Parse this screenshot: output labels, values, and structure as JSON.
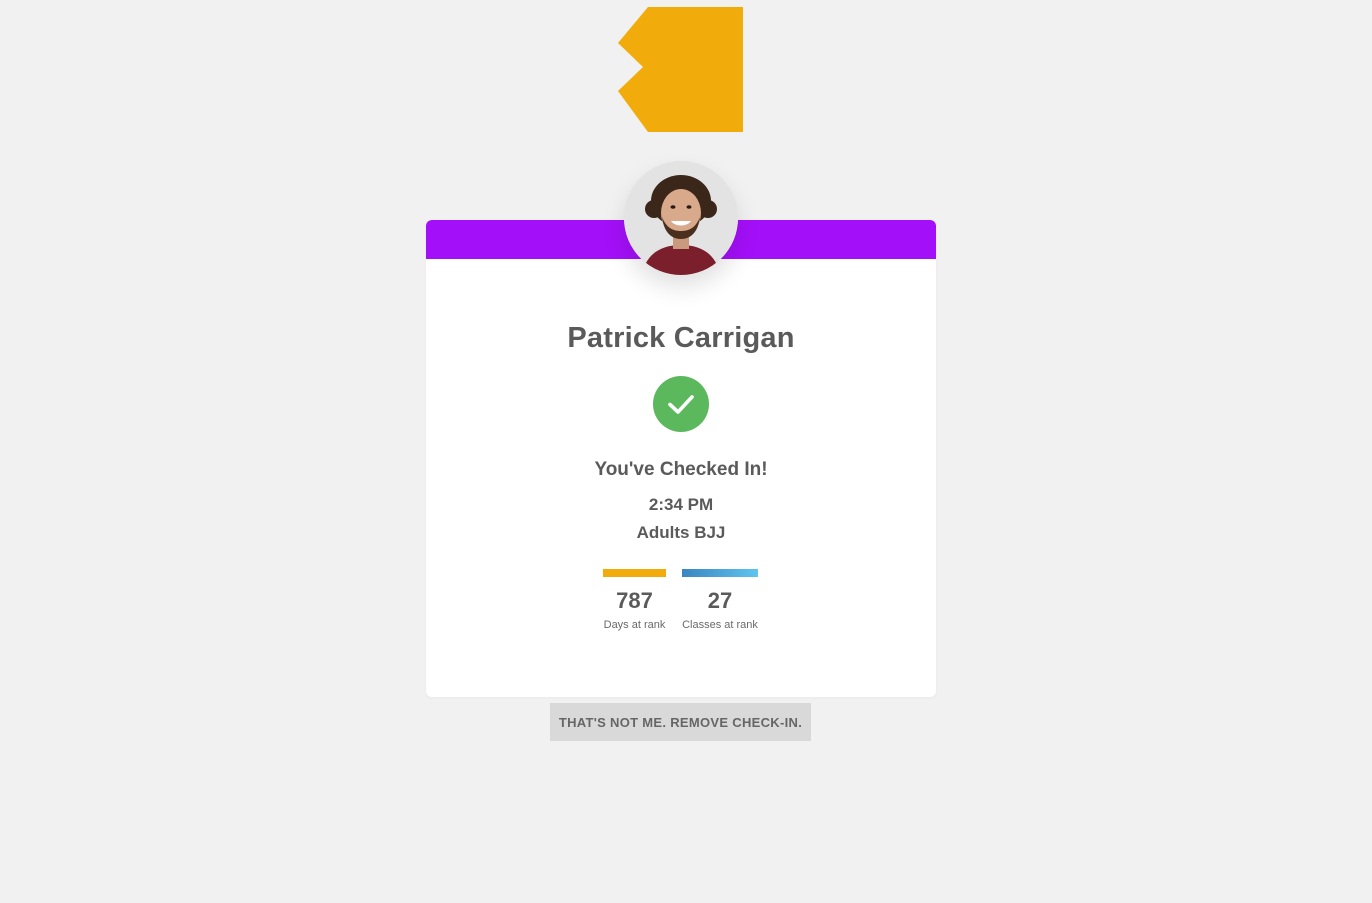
{
  "brand": {
    "logo_icon": "k-logo-icon",
    "logo_color": "#f1ab0a"
  },
  "header": {
    "band_color": "#a40ff9"
  },
  "member": {
    "name": "Patrick Carrigan",
    "avatar_icon": "member-photo"
  },
  "checkin": {
    "status_icon": "check-icon",
    "status_color": "#5cb85c",
    "status_text": "You've Checked In!",
    "time": "2:34 PM",
    "class_name": "Adults BJJ"
  },
  "stats": {
    "days": {
      "value": "787",
      "label": "Days at rank",
      "color": "#f1ab0a"
    },
    "classes": {
      "value": "27",
      "label": "Classes at rank",
      "color": "#3a85c0"
    }
  },
  "actions": {
    "remove_label": "That's not me. Remove check-in."
  }
}
